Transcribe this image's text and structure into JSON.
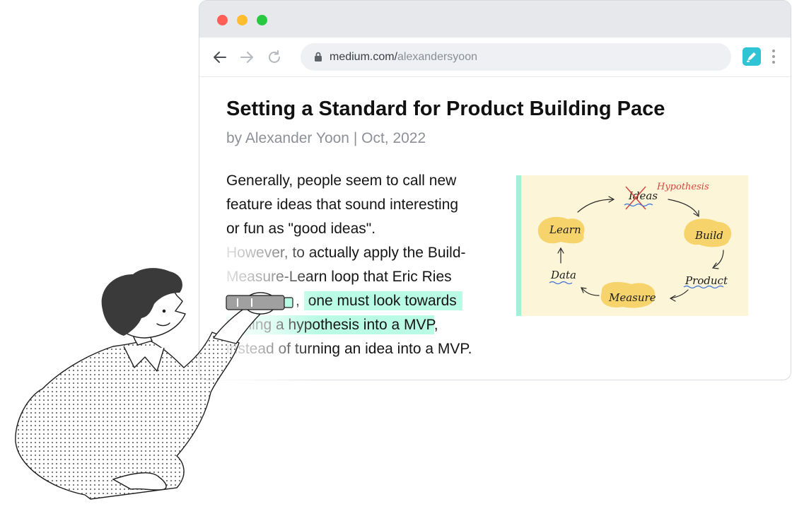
{
  "browser": {
    "url_domain": "medium.com/",
    "url_path": "alexandersyoon",
    "icons": {
      "back": "back-arrow-icon",
      "forward": "forward-arrow-icon",
      "reload": "reload-icon",
      "lock": "lock-icon",
      "extension": "highlighter-extension-icon",
      "menu": "more-vertical-icon"
    },
    "colors": {
      "close": "#ff5f57",
      "minimize": "#febc2e",
      "maximize": "#28c840",
      "extension": "#2ec4d6"
    }
  },
  "article": {
    "title": "Setting a Standard for Product Building Pace",
    "byline": "by Alexander Yoon | Oct, 2022",
    "lines": [
      "Generally, people seem to call new",
      "feature ideas that sound interesting",
      "or fun as \"good ideas\".",
      "However, to actually apply the Build-",
      "Measure-Learn loop that Eric Ries",
      ",",
      "one must look towards",
      "turning a hypothesis into a MVP",
      ",",
      "instead of turning an idea into a MVP."
    ],
    "highlight_color": "#b9fbe5"
  },
  "figure": {
    "labels": {
      "ideas": "Ideas",
      "hypothesis": "Hypothesis",
      "build": "Build",
      "product": "Product",
      "measure": "Measure",
      "data": "Data",
      "learn": "Learn"
    },
    "colors": {
      "blob": "#f6d36b",
      "accent_bar": "#9ff2d8",
      "correction": "#d9453f",
      "underline": "#3b6fd8"
    }
  }
}
